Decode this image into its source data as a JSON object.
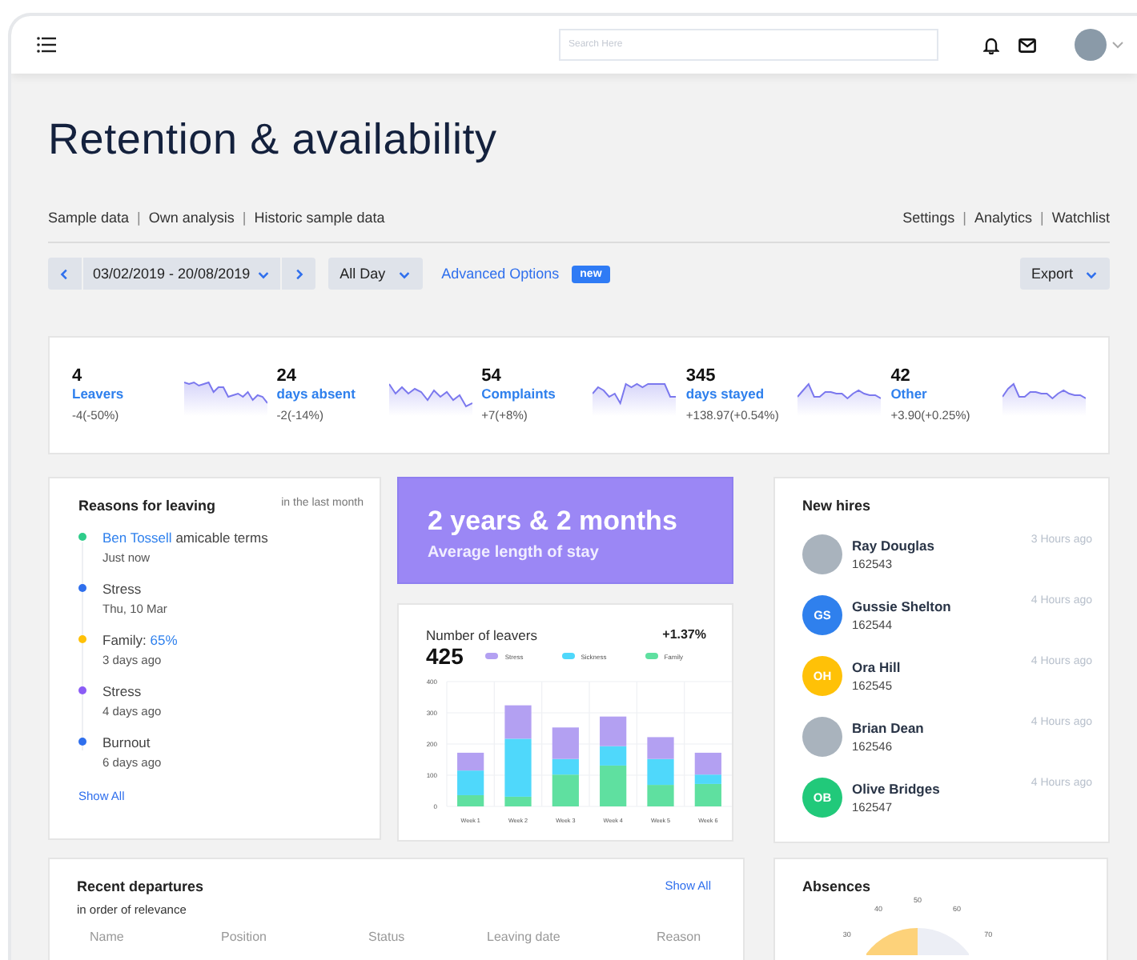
{
  "header": {
    "search": {
      "placeholder": "Search Here"
    }
  },
  "title": "Retention & availability",
  "separator": "|",
  "left_links": [
    "Sample data",
    "Own analysis",
    "Historic sample data"
  ],
  "right_links": [
    "Settings",
    "Analytics",
    "Watchlist"
  ],
  "toolbar": {
    "date_range": "03/02/2019 - 20/08/2019",
    "period": "All Day",
    "advanced": "Advanced Options",
    "badge": "new",
    "export": "Export"
  },
  "stats": [
    {
      "value": "4",
      "label": "Leavers",
      "change": "-4(-50%)"
    },
    {
      "value": "24",
      "label": "days absent",
      "change": "-2(-14%)"
    },
    {
      "value": "54",
      "label": "Complaints",
      "change": "+7(+8%)"
    },
    {
      "value": "345",
      "label": "days stayed",
      "change": "+138.97(+0.54%)"
    },
    {
      "value": "42",
      "label": "Other",
      "change": "+3.90(+0.25%)"
    }
  ],
  "reasons": {
    "title": "Reasons for leaving",
    "period": "in the last month",
    "show_all": "Show All",
    "items": [
      {
        "color": "#2ecc8a",
        "parts": [
          {
            "kind": "link",
            "text": "Ben Tossell"
          },
          {
            "kind": "plain",
            "text": " amicable terms"
          }
        ],
        "time": "Just now"
      },
      {
        "color": "#2f6fed",
        "parts": [
          {
            "kind": "plain",
            "text": "Stress"
          }
        ],
        "time": "Thu, 10 Mar"
      },
      {
        "color": "#ffc107",
        "parts": [
          {
            "kind": "plain",
            "text": "Family: "
          },
          {
            "kind": "link",
            "text": "65%"
          }
        ],
        "time": "3 days ago"
      },
      {
        "color": "#8b5cf6",
        "parts": [
          {
            "kind": "plain",
            "text": "Stress"
          }
        ],
        "time": "4 days ago"
      },
      {
        "color": "#2f6fed",
        "parts": [
          {
            "kind": "plain",
            "text": "Burnout"
          }
        ],
        "time": "6 days ago"
      }
    ]
  },
  "highlight": {
    "value": "2 years & 2 months",
    "label": "Average length of stay"
  },
  "leavers": {
    "title": "Number of leavers",
    "total": "425",
    "change": "+1.37%",
    "chart_data": {
      "type": "bar",
      "stacked": true,
      "grid": true,
      "categories": [
        "Week 1",
        "Week 2",
        "Week 3",
        "Week 4",
        "Week 5",
        "Week 6"
      ],
      "ylim": [
        0,
        400
      ],
      "yticks": [
        0,
        100,
        200,
        300,
        400
      ],
      "series": [
        {
          "name": "Family",
          "color": "#5fe0a0",
          "values": [
            36,
            31,
            102,
            131,
            69,
            72
          ]
        },
        {
          "name": "Sickness",
          "color": "#4fd8fb",
          "values": [
            79,
            186,
            50,
            62,
            83,
            30
          ]
        },
        {
          "name": "Stress",
          "color": "#b3a0f2",
          "values": [
            57,
            107,
            101,
            95,
            70,
            70
          ]
        }
      ]
    }
  },
  "new_hires": {
    "title": "New hires",
    "items": [
      {
        "kind": "photo",
        "name": "Ray Douglas",
        "id": "162543",
        "time": "3 Hours ago"
      },
      {
        "kind": "initials",
        "initials": "GS",
        "color": "#2f80ed",
        "name": "Gussie Shelton",
        "id": "162544",
        "time": "4 Hours ago"
      },
      {
        "kind": "initials",
        "initials": "OH",
        "color": "#ffc107",
        "name": "Ora Hill",
        "id": "162545",
        "time": "4 Hours ago"
      },
      {
        "kind": "photo",
        "name": "Brian Dean",
        "id": "162546",
        "time": "4 Hours ago"
      },
      {
        "kind": "initials",
        "initials": "OB",
        "color": "#21c97a",
        "name": "Olive Bridges",
        "id": "162547",
        "time": "4 Hours ago"
      }
    ]
  },
  "departures": {
    "title": "Recent departures",
    "subtitle": "in order of relevance",
    "show_all": "Show All",
    "columns": [
      "Name",
      "Position",
      "Status",
      "Leaving date",
      "Reason"
    ]
  },
  "absences": {
    "title": "Absences",
    "gauge_ticks": [
      "30",
      "40",
      "50",
      "60",
      "70"
    ]
  }
}
